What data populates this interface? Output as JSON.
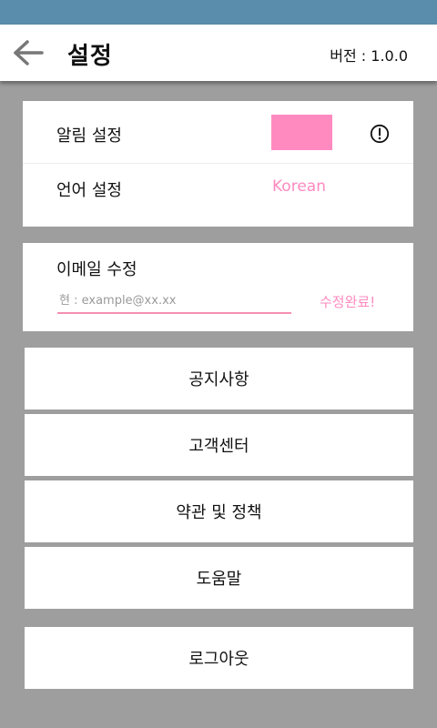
{
  "header": {
    "title": "설정",
    "version": "버전 : 1.0.0"
  },
  "settings": {
    "notification_label": "알림 설정",
    "notification_color": "#ff8ac0",
    "language_label": "언어 설정",
    "language_value": "Korean"
  },
  "email": {
    "label": "이메일 수정",
    "placeholder": "현 : example@xx.xx",
    "done_label": "수정완료!"
  },
  "menu": {
    "notice": "공지사항",
    "support": "고객센터",
    "terms": "약관 및 정책",
    "help": "도움말",
    "logout": "로그아웃"
  },
  "colors": {
    "status_bar": "#5a8cac",
    "accent": "#ff8ac0",
    "background": "#9e9e9e"
  }
}
